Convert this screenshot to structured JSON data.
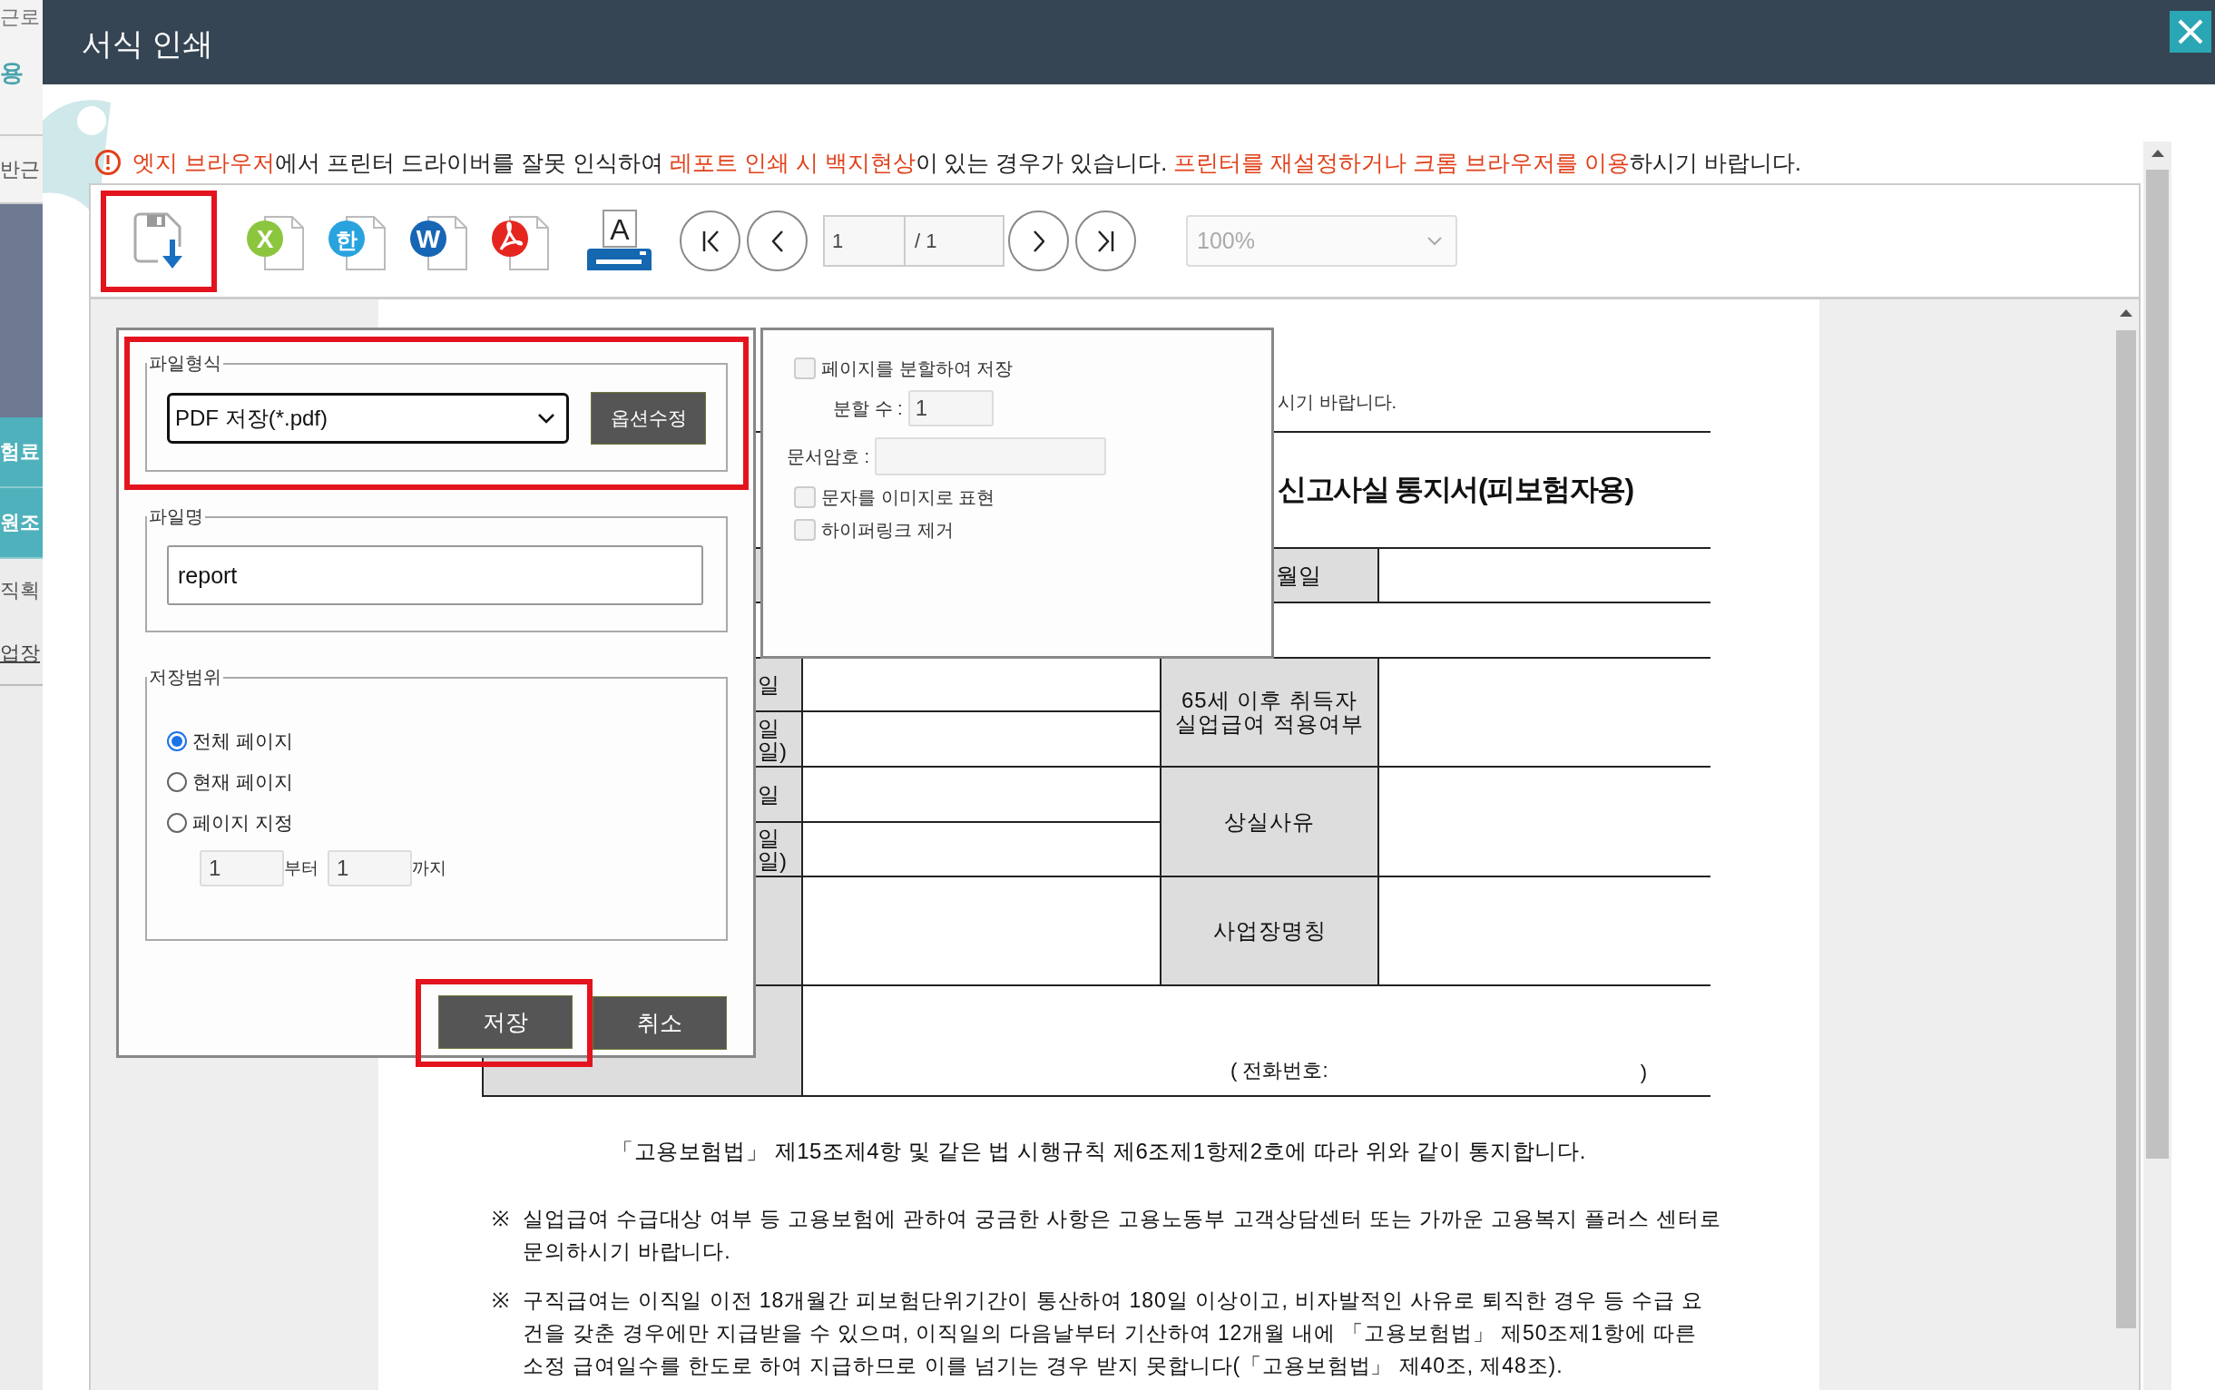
{
  "background_page": {
    "fragments": [
      {
        "kind": "top",
        "text": "근로"
      },
      {
        "kind": "brand",
        "text": "용"
      },
      {
        "kind": "plain",
        "text": "반근"
      },
      {
        "kind": "block"
      },
      {
        "kind": "tab",
        "text": "험료"
      },
      {
        "kind": "tab",
        "text": "원조"
      },
      {
        "kind": "item",
        "text": "직획"
      },
      {
        "kind": "link",
        "text": "업장"
      }
    ]
  },
  "window": {
    "title": "서식 인쇄"
  },
  "warning": {
    "segments": [
      {
        "text": "엣지 브라우저",
        "emphasis": true
      },
      {
        "text": "에서 프린터 드라이버를 잘못 인식하여 ",
        "emphasis": false
      },
      {
        "text": "레포트 인쇄 시 백지현상",
        "emphasis": true
      },
      {
        "text": "이 있는 경우가 있습니다. ",
        "emphasis": false
      },
      {
        "text": "프린터를 재설정하거나 크롬 브라우저를 이용",
        "emphasis": true
      },
      {
        "text": "하시기 바랍니다.",
        "emphasis": false
      }
    ]
  },
  "toolbar": {
    "buttons": [
      {
        "kind": "save",
        "highlighted": true
      },
      {
        "kind": "excel",
        "glyph": "X",
        "highlighted": false
      },
      {
        "kind": "hwp",
        "glyph": "한",
        "highlighted": false
      },
      {
        "kind": "word",
        "glyph": "W",
        "highlighted": false
      },
      {
        "kind": "pdf",
        "highlighted": false
      },
      {
        "kind": "print",
        "glyph": "A",
        "highlighted": false
      },
      {
        "kind": "first",
        "highlighted": false
      },
      {
        "kind": "prev",
        "highlighted": false
      },
      {
        "kind": "next",
        "highlighted": false
      },
      {
        "kind": "last",
        "highlighted": false
      }
    ],
    "page_field": "1",
    "page_total": "/ 1",
    "zoom": {
      "value": "100%",
      "disabled": true
    }
  },
  "export_dialog": {
    "file_format": {
      "legend": "파일형식",
      "value": "PDF 저장(*.pdf)",
      "option_button": "옵션수정",
      "highlighted": true
    },
    "file_name": {
      "legend": "파일명",
      "value": "report"
    },
    "range": {
      "legend": "저장범위",
      "options": [
        {
          "label": "전체 페이지",
          "selected": true
        },
        {
          "label": "현재 페이지",
          "selected": false
        },
        {
          "label": "페이지 지정",
          "selected": false
        }
      ],
      "from": "1",
      "from_label": "부터",
      "to": "1",
      "to_label": "까지"
    },
    "buttons": [
      {
        "label": "저장",
        "highlighted": true
      },
      {
        "label": "취소",
        "highlighted": false
      }
    ]
  },
  "pdf_options": {
    "items": [
      {
        "kind": "checkbox",
        "label": "페이지를 분할하여 저장",
        "checked": false
      },
      {
        "kind": "subfield",
        "label": "분할 수 :",
        "value": "1"
      },
      {
        "kind": "field",
        "label": "문서암호 :"
      },
      {
        "kind": "checkbox",
        "label": "문자를 이미지로 표현",
        "checked": false
      },
      {
        "kind": "checkbox",
        "label": "하이퍼링크 제거",
        "checked": false
      }
    ]
  },
  "document": {
    "intro_tail": "시기 바랍니다.",
    "title": "신고사실 통지서(피보험자용)",
    "date_label": "월일",
    "side_cells": [
      "일",
      "일\n일)",
      "일",
      "일\n일)"
    ],
    "labels": [
      "65세 이후 취득자\n실업급여 적용여부",
      "상실사유",
      "사업장명칭"
    ],
    "phone_label": "( 전화번호:",
    "phone_close": ")",
    "notice": "「고용보험법」 제15조제4항 및 같은 법 시행규칙 제6조제1항제2호에 따라 위와 같이 통지합니다.",
    "notes": [
      {
        "mark": "※",
        "text": "실업급여 수급대상 여부 등 고용보험에 관하여 궁금한 사항은 고용노동부 고객상담센터 또는 가까운 고용복지 플러스 센터로 문의하시기 바랍니다."
      },
      {
        "mark": "※",
        "text": "구직급여는 이직일 이전 18개월간 피보험단위기간이 통산하여 180일 이상이고, 비자발적인 사유로 퇴직한 경우 등 수급 요건을 갖춘 경우에만 지급받을 수 있으며, 이직일의 다음날부터 기산하여 12개월 내에 「고용보험법」 제50조제1항에 따른 소정 급여일수를 한도로 하여 지급하므로 이를 넘기는 경우 받지 못합니다(「고용보험법」 제40조, 제48조)."
      }
    ]
  }
}
